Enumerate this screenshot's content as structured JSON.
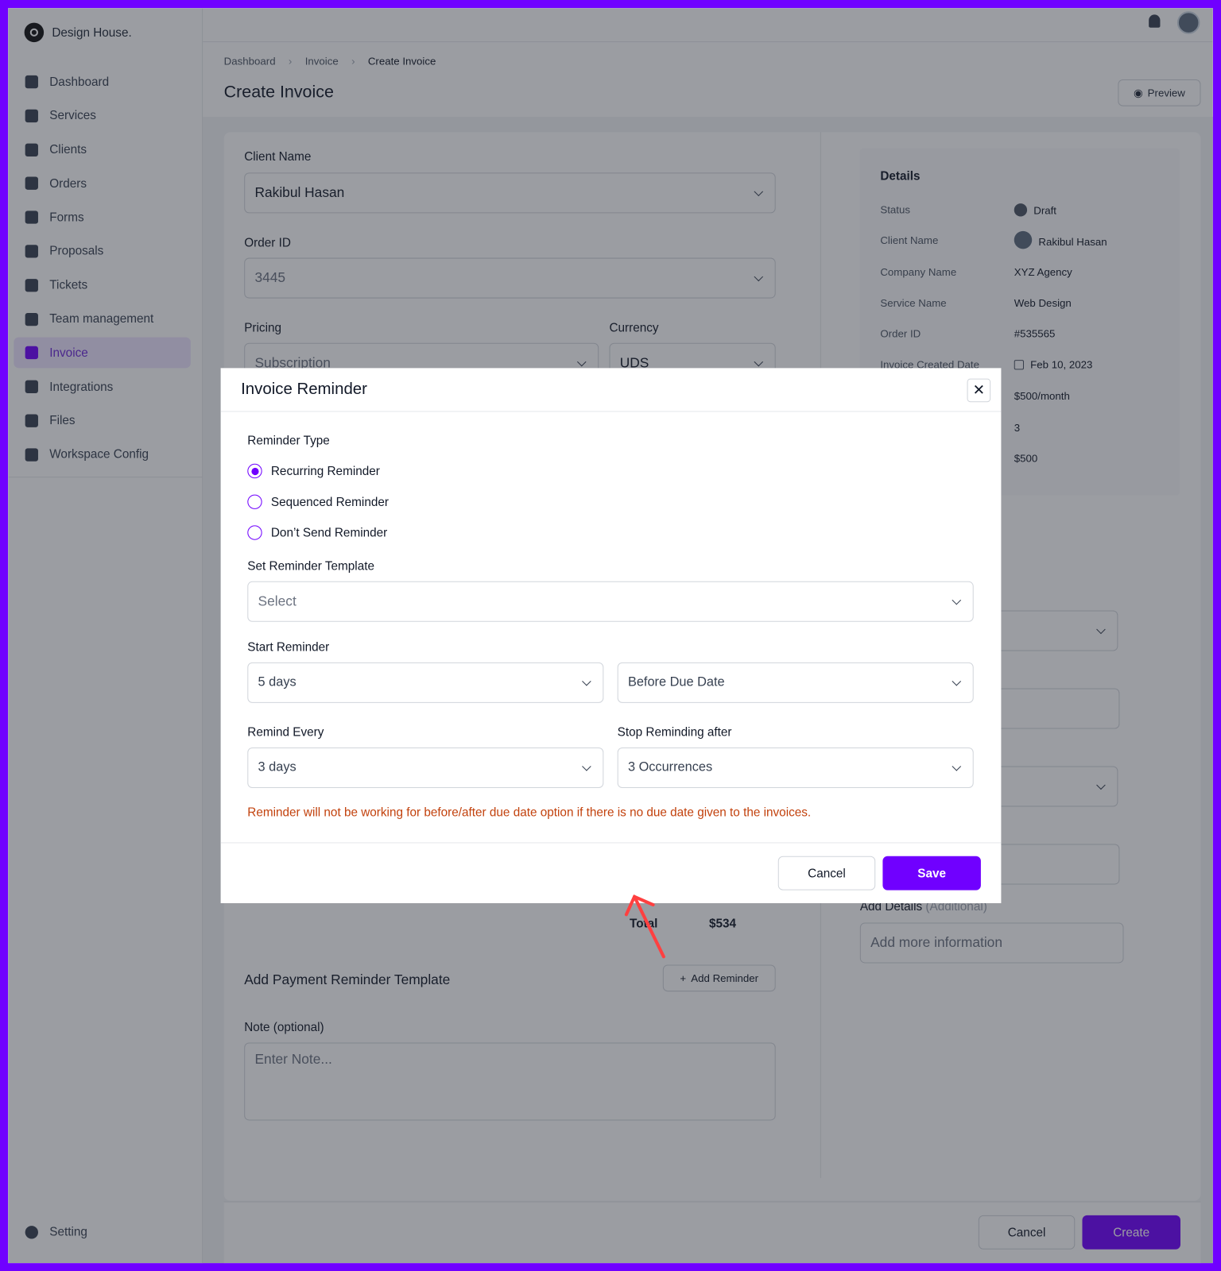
{
  "brand": {
    "name": "Design House."
  },
  "sidebar": {
    "items": [
      {
        "label": "Dashboard"
      },
      {
        "label": "Services"
      },
      {
        "label": "Clients"
      },
      {
        "label": "Orders"
      },
      {
        "label": "Forms"
      },
      {
        "label": "Proposals"
      },
      {
        "label": "Tickets"
      },
      {
        "label": "Team management"
      },
      {
        "label": "Invoice",
        "active": true
      },
      {
        "label": "Integrations"
      },
      {
        "label": "Files"
      },
      {
        "label": "Workspace Config"
      }
    ],
    "setting": "Setting"
  },
  "breadcrumb": [
    "Dashboard",
    "Invoice",
    "Create Invoice"
  ],
  "header": {
    "title": "Create Invoice",
    "preview": "Preview"
  },
  "form": {
    "client_label": "Client Name",
    "client_value": "Rakibul Hasan",
    "order_label": "Order ID",
    "order_value": "3445",
    "pricing_label": "Pricing",
    "pricing_value": "Subscription",
    "currency_label": "Currency",
    "currency_value": "UDS",
    "total_label": "Total",
    "total_value": "$534",
    "reminder_title": "Add Payment Reminder Template",
    "add_reminder": "Add Reminder",
    "note_label": "Note (optional)",
    "note_placeholder": "Enter Note...",
    "add_details_label": "Add Details",
    "add_details_hint": "(Additional)",
    "add_details_placeholder": "Add more information"
  },
  "details": {
    "title": "Details",
    "rows": [
      {
        "label": "Status",
        "value": "Draft"
      },
      {
        "label": "Client Name",
        "value": "Rakibul Hasan"
      },
      {
        "label": "Company Name",
        "value": "XYZ Agency"
      },
      {
        "label": "Service Name",
        "value": "Web Design"
      },
      {
        "label": "Order ID",
        "value": "#535565"
      },
      {
        "label": "Invoice Created Date",
        "value": "Feb 10, 2023"
      },
      {
        "label": "",
        "value": "$500/month"
      },
      {
        "label": "",
        "value": "3"
      },
      {
        "label": "",
        "value": "$500"
      }
    ]
  },
  "footer": {
    "cancel": "Cancel",
    "create": "Create"
  },
  "modal": {
    "title": "Invoice Reminder",
    "reminder_type_label": "Reminder Type",
    "options": [
      "Recurring Reminder",
      "Sequenced Reminder",
      "Don’t Send Reminder"
    ],
    "selected": "Recurring Reminder",
    "template_label": "Set Reminder Template",
    "template_placeholder": "Select",
    "start_label": "Start Reminder",
    "start_value": "5 days",
    "start_relation": "Before Due Date",
    "every_label": "Remind Every",
    "every_value": "3 days",
    "stop_label": "Stop Reminding after",
    "stop_value": "3 Occurrences",
    "warning": "Reminder will not be working for before/after due date option if there is no due date given to the invoices.",
    "cancel": "Cancel",
    "save": "Save"
  },
  "colors": {
    "accent": "#7000ff",
    "warning": "#c2410c",
    "annotation_arrow": "#ff4040"
  }
}
